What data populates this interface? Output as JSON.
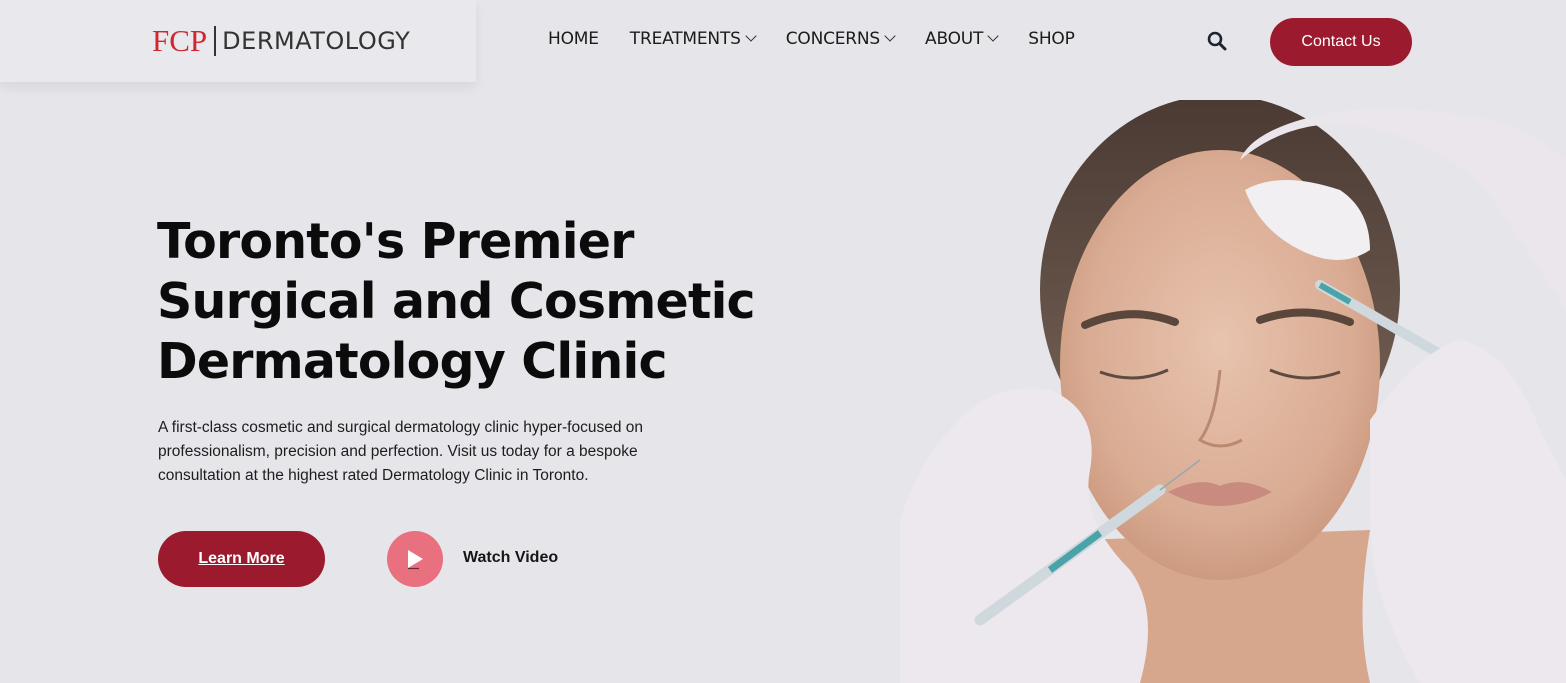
{
  "brand": {
    "fcp": "FCP",
    "name": "DERMATOLOGY",
    "accent": "#d0282f"
  },
  "nav": {
    "items": [
      {
        "label": "HOME",
        "dropdown": false
      },
      {
        "label": "TREATMENTS",
        "dropdown": true
      },
      {
        "label": "CONCERNS",
        "dropdown": true
      },
      {
        "label": "ABOUT",
        "dropdown": true
      },
      {
        "label": "SHOP",
        "dropdown": false
      }
    ],
    "search_icon": "search-icon",
    "contact_label": "Contact Us"
  },
  "hero": {
    "title_lines": [
      "Toronto's Premier",
      "Surgical and Cosmetic",
      "Dermatology Clinic"
    ],
    "description": "A first-class cosmetic and surgical dermatology clinic hyper-focused on professionalism, precision and perfection. Visit us today for a bespoke consultation at the highest rated Dermatology Clinic in Toronto.",
    "learn_more_label": "Learn More",
    "watch_video_label": "Watch Video",
    "image_icon": "face-injection-photo"
  },
  "colors": {
    "primary": "#9b1a2d",
    "play": "#e8707f",
    "background": "#e6e5ea"
  }
}
